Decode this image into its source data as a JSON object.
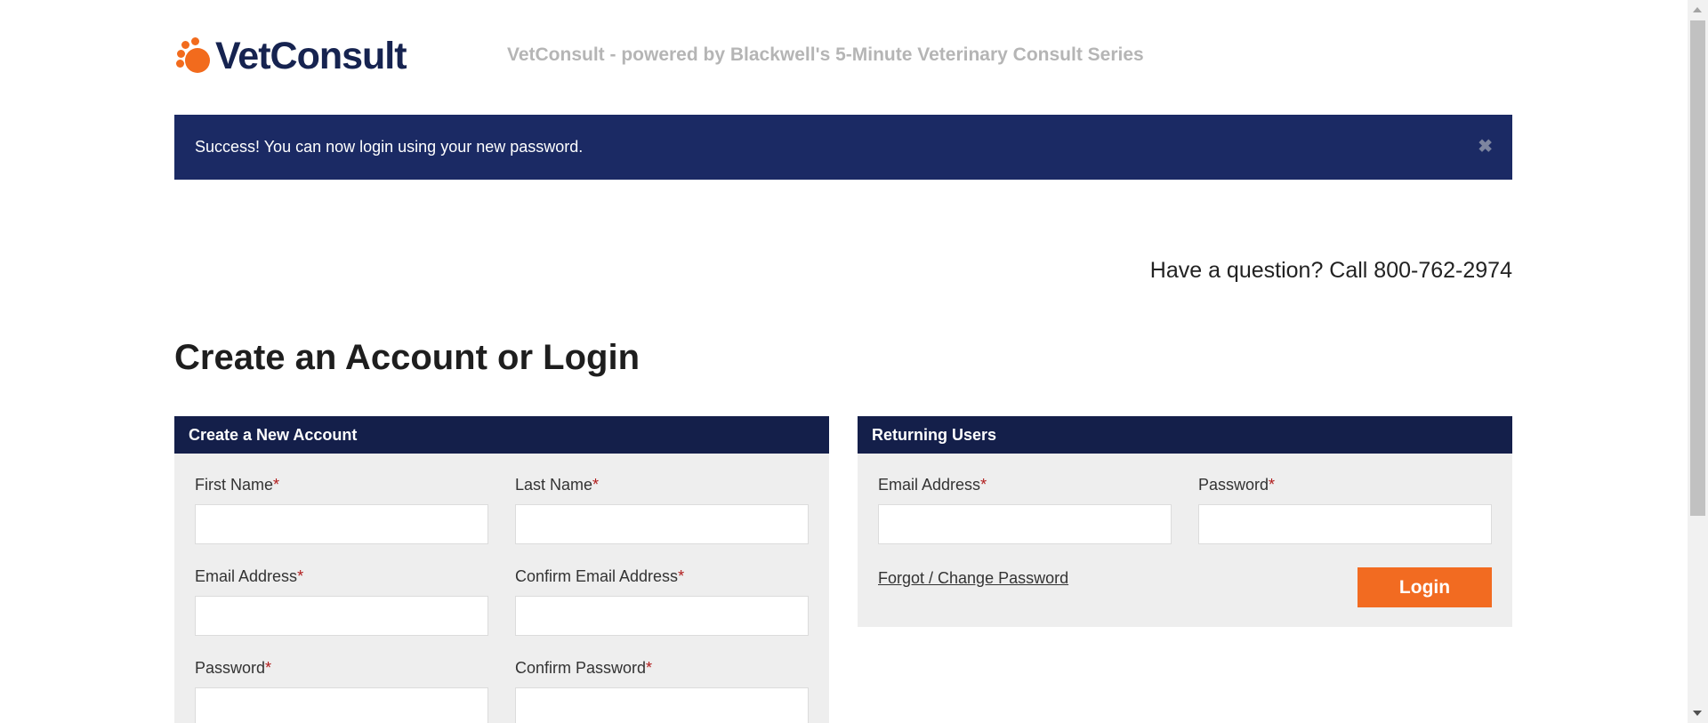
{
  "header": {
    "logo_text": "VetConsult",
    "tagline": "VetConsult - powered by Blackwell's 5-Minute Veterinary Consult Series"
  },
  "alert": {
    "message": "Success! You can now login using your new password.",
    "close_glyph": "✖"
  },
  "contact": {
    "question": "Have a question? Call 800-762-2974"
  },
  "page": {
    "title": "Create an Account or Login"
  },
  "create_account": {
    "header": "Create a New Account",
    "required_mark": "*",
    "fields": {
      "first_name": {
        "label": "First Name",
        "value": ""
      },
      "last_name": {
        "label": "Last Name",
        "value": ""
      },
      "email": {
        "label": "Email Address",
        "value": ""
      },
      "confirm_email": {
        "label": "Confirm Email Address",
        "value": ""
      },
      "password": {
        "label": "Password",
        "value": ""
      },
      "confirm_password": {
        "label": "Confirm Password",
        "value": ""
      }
    }
  },
  "returning_users": {
    "header": "Returning Users",
    "required_mark": "*",
    "fields": {
      "email": {
        "label": "Email Address",
        "value": ""
      },
      "password": {
        "label": "Password",
        "value": ""
      }
    },
    "forgot_link": "Forgot / Change Password",
    "login_button": "Login"
  },
  "colors": {
    "brand_navy": "#162350",
    "brand_orange": "#f26b1d",
    "alert_background": "#1b2a64",
    "panel_header": "#141f4a",
    "panel_background": "#eeeeee",
    "required": "#b01c1c"
  },
  "icons": {
    "logo": "paw-icon",
    "alert_close": "close-icon"
  }
}
